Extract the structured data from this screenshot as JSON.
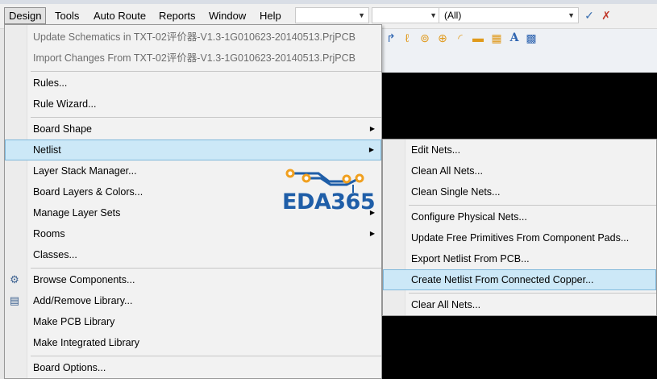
{
  "menubar": {
    "items": [
      "Design",
      "Tools",
      "Auto Route",
      "Reports",
      "Window",
      "Help"
    ],
    "combo1": "",
    "combo2": "",
    "combo3": "(All)"
  },
  "design_menu": {
    "items": [
      {
        "label": "Update Schematics in TXT-02评价器-V1.3-1G010623-20140513.PrjPCB",
        "disabled": true
      },
      {
        "label": "Import Changes From TXT-02评价器-V1.3-1G010623-20140513.PrjPCB",
        "disabled": true
      },
      {
        "label": "Rules..."
      },
      {
        "label": "Rule Wizard..."
      },
      {
        "label": "Board Shape",
        "submenu": true
      },
      {
        "label": "Netlist",
        "submenu": true,
        "highlighted": true
      },
      {
        "label": "Layer Stack Manager..."
      },
      {
        "label": "Board Layers & Colors..."
      },
      {
        "label": "Manage Layer Sets",
        "submenu": true
      },
      {
        "label": "Rooms",
        "submenu": true
      },
      {
        "label": "Classes..."
      },
      {
        "label": "Browse Components...",
        "icon": "browse-components-icon"
      },
      {
        "label": "Add/Remove Library...",
        "icon": "library-book-icon"
      },
      {
        "label": "Make PCB Library"
      },
      {
        "label": "Make Integrated Library"
      },
      {
        "label": "Board Options..."
      }
    ]
  },
  "netlist_submenu": {
    "items": [
      {
        "label": "Edit Nets..."
      },
      {
        "label": "Clean All Nets..."
      },
      {
        "label": "Clean Single Nets..."
      },
      {
        "label": "Configure Physical Nets..."
      },
      {
        "label": "Update Free Primitives From Component Pads..."
      },
      {
        "label": "Export Netlist From PCB..."
      },
      {
        "label": "Create Netlist From Connected Copper...",
        "highlighted": true
      },
      {
        "label": "Clear All Nets..."
      }
    ]
  },
  "logo": {
    "text": "EDA365"
  },
  "colors": {
    "highlight": "#cce8f7",
    "highlight_border": "#7fb8db",
    "logo_blue": "#1f5ea8",
    "logo_orange": "#f0a020"
  }
}
